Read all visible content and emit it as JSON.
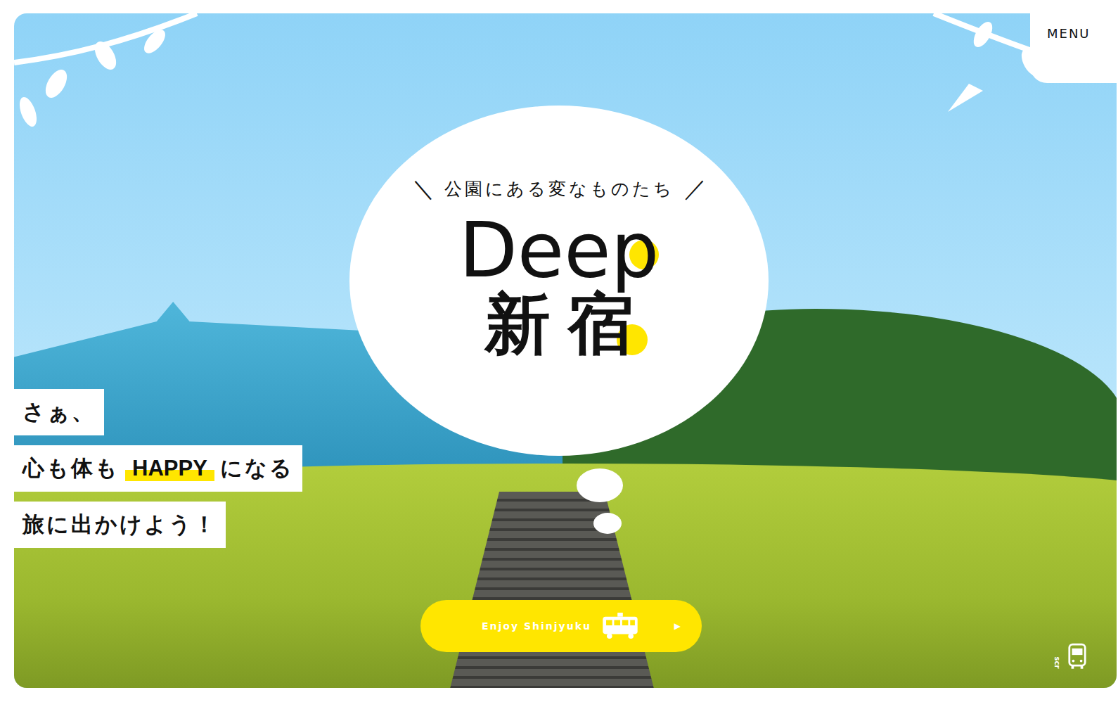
{
  "menu": {
    "label": "MENU"
  },
  "hero": {
    "subtitle": "公園にある変なものたち",
    "marks": [
      "＼",
      "／"
    ],
    "title_lines": [
      "Deep",
      "新宿"
    ]
  },
  "tagline": [
    [
      {
        "text": "さぁ、",
        "highlight": false
      }
    ],
    [
      {
        "text": "心も体も",
        "highlight": false
      },
      {
        "text": "HAPPY",
        "highlight": true
      },
      {
        "text": "になる",
        "highlight": false
      }
    ],
    [
      {
        "text": "旅に出かけよう！",
        "highlight": false
      }
    ]
  ],
  "cta": {
    "label": "Enjoy Shinjyuku",
    "arrow": "▶"
  },
  "scroll": {
    "label": "scr"
  }
}
